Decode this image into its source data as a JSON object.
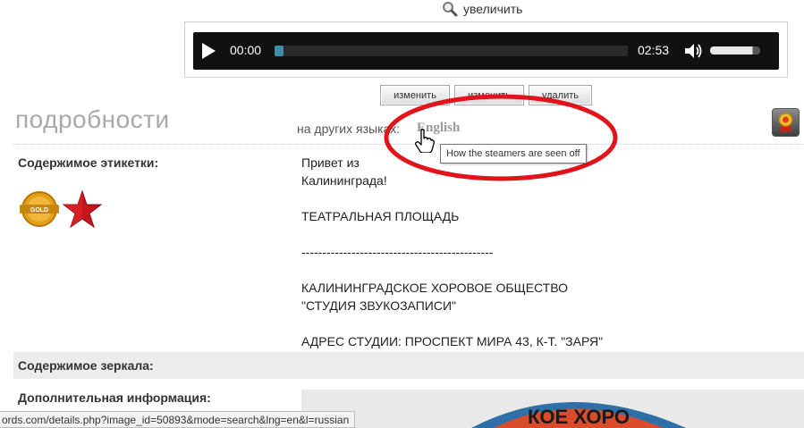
{
  "zoom": {
    "label": "увеличить",
    "icon": "magnifier-icon"
  },
  "player": {
    "current_time": "00:00",
    "duration": "02:53",
    "progress": 0.0,
    "volume": 0.85,
    "accent": "#3b8fa6"
  },
  "actions": {
    "edit1": "изменить",
    "edit2": "изменить",
    "delete": "удалить"
  },
  "details": {
    "title": "подробности",
    "other_languages_label": "на других языках:",
    "english_link": "English",
    "tooltip": "How the steamers are seen off"
  },
  "label_contents": {
    "label": "Содержимое этикетки:",
    "badges": [
      "gold-medal-icon",
      "red-star-icon"
    ],
    "gold_text": "GOLD",
    "text": "Привет из\nКалининграда!\n\nТЕАТРАЛЬНАЯ ПЛОЩАДЬ\n\n----------------------------------------------\n\nКАЛИНИНГРАДСКОЕ ХОРОВОЕ ОБЩЕСТВО\n\"СТУДИЯ ЗВУКОЗАПИСИ\"\n\nАДРЕС СТУДИИ: ПРОСПЕКТ МИРА 43, К-Т. \"ЗАРЯ\""
  },
  "mirror": {
    "label": "Содержимое зеркала:"
  },
  "additional": {
    "label": "Дополнительная информация:"
  },
  "record_text": "КОЕ ХОРО",
  "status_url": "ords.com/details.php?image_id=50893&mode=search&lng=en&l=russian",
  "colors": {
    "highlight_oval": "#e0141a",
    "star": "#c4161c",
    "gold": "#e3a019"
  }
}
